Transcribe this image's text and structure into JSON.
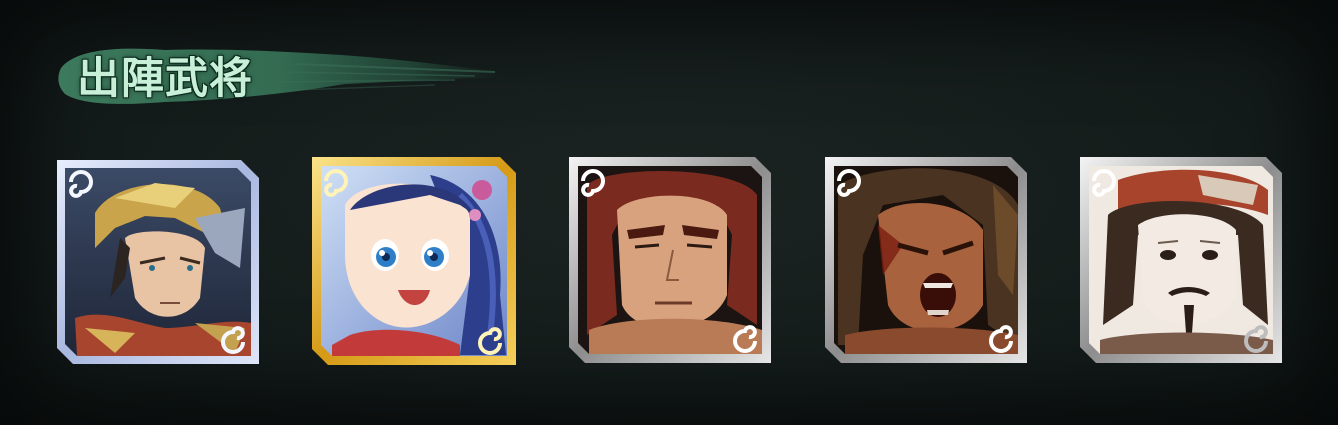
{
  "section": {
    "title": "出陣武将"
  },
  "generals": [
    {
      "frame": "silver-blue",
      "portrait_icon": "armored-warrior-portrait-icon",
      "accent": "#b9c7ea"
    },
    {
      "frame": "gold",
      "portrait_icon": "smiling-girl-portrait-icon",
      "accent": "#e2b21e"
    },
    {
      "frame": "silver",
      "portrait_icon": "red-haired-warrior-portrait-icon",
      "accent": "#c9c9c9"
    },
    {
      "frame": "silver",
      "portrait_icon": "shouting-warrior-portrait-icon",
      "accent": "#c9c9c9"
    },
    {
      "frame": "silver",
      "portrait_icon": "bearded-scholar-portrait-icon",
      "accent": "#c9c9c9"
    }
  ]
}
